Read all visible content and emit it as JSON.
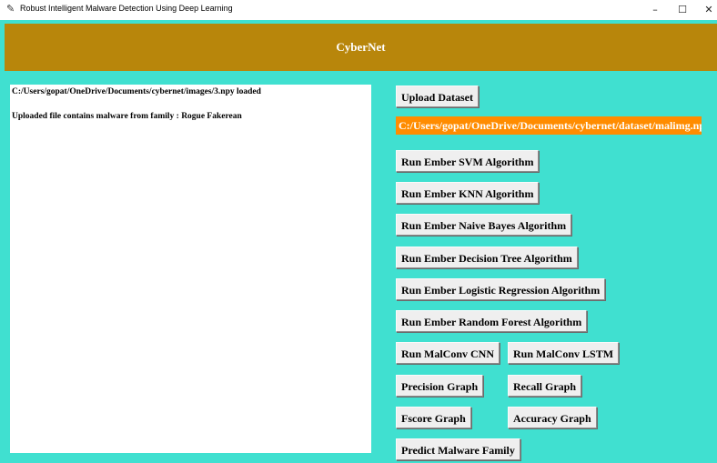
{
  "window": {
    "title": "Robust Intelligent Malware Detection Using Deep Learning",
    "minimize": "–",
    "maximize": "☐",
    "close": "✕"
  },
  "header": {
    "title": "CyberNet"
  },
  "output": {
    "line1": "C:/Users/gopat/OneDrive/Documents/cybernet/images/3.npy loaded",
    "line2": "Uploaded file contains malware from family : Rogue Fakerean"
  },
  "controls": {
    "upload_dataset": "Upload  Dataset",
    "dataset_path": "C:/Users/gopat/OneDrive/Documents/cybernet/dataset/malimg.npz",
    "svm": "Run Ember SVM Algorithm",
    "knn": "Run Ember KNN Algorithm",
    "naive_bayes": "Run Ember Naive Bayes Algorithm",
    "decision_tree": "Run Ember Decision Tree Algorithm",
    "logistic_regression": "Run Ember Logistic Regression Algorithm",
    "random_forest": "Run Ember Random Forest Algorithm",
    "malconv_cnn": "Run MalConv CNN",
    "malconv_lstm": "Run MalConv LSTM",
    "precision_graph": "Precision Graph",
    "recall_graph": "Recall Graph",
    "fscore_graph": "Fscore Graph",
    "accuracy_graph": "Accuracy Graph",
    "predict": "Predict Malware Family"
  }
}
